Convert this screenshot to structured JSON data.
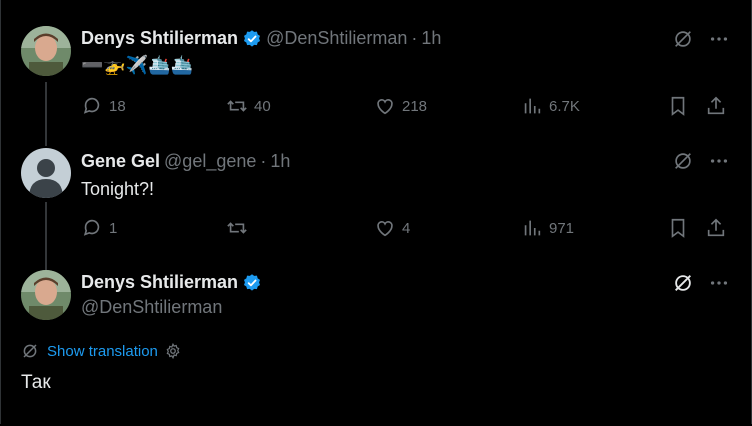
{
  "tweets": [
    {
      "name": "Denys Shtilierman",
      "handle": "@DenShtilierman",
      "time": "1h",
      "text": "➖🚁✈️🛳️🛳️",
      "replies": "18",
      "reposts": "40",
      "likes": "218",
      "views": "6.7K"
    },
    {
      "name": "Gene Gel",
      "handle": "@gel_gene",
      "time": "1h",
      "text": "Tonight?!",
      "replies": "1",
      "reposts": "",
      "likes": "4",
      "views": "971"
    }
  ],
  "main_tweet": {
    "name": "Denys Shtilierman",
    "handle": "@DenShtilierman",
    "translation_label": "Show translation",
    "text": "Так"
  },
  "colors": {
    "accent": "#1d9bf0",
    "muted": "#71767b",
    "text": "#e7e9ea",
    "background": "#000000"
  }
}
